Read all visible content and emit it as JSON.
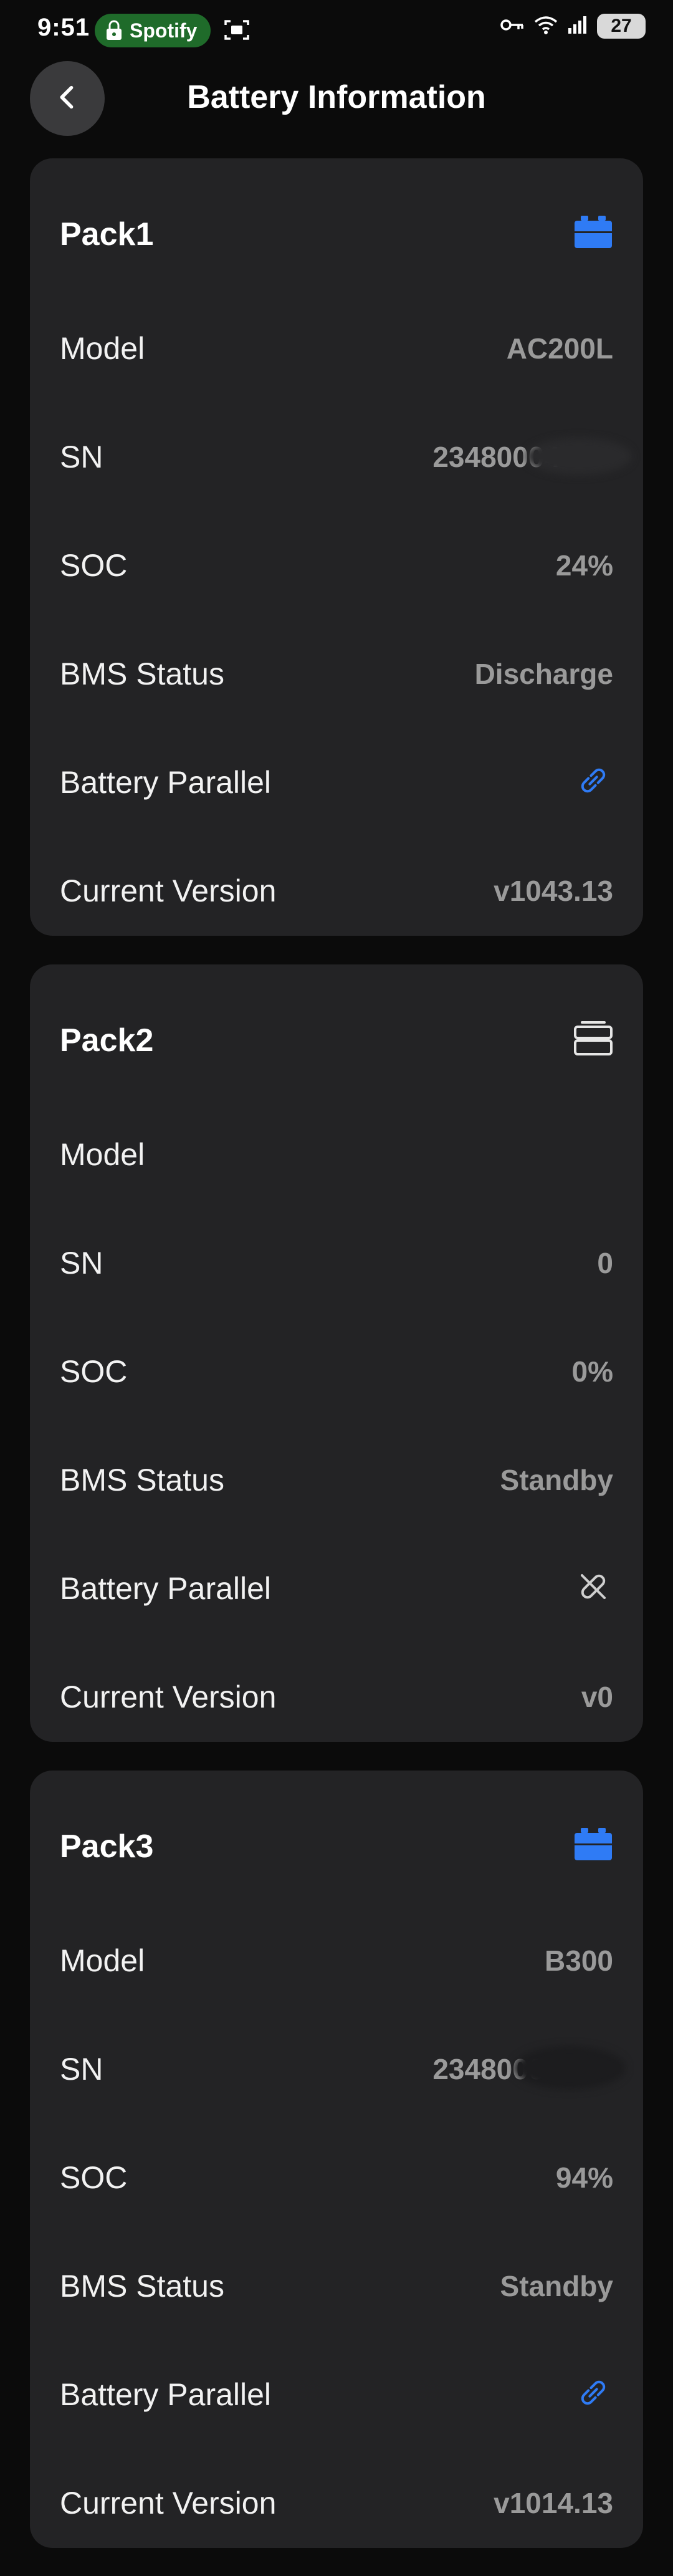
{
  "status_bar": {
    "time": "9:51",
    "app_pill": "Spotify",
    "battery": "27"
  },
  "header": {
    "title": "Battery Information"
  },
  "labels": {
    "model": "Model",
    "sn": "SN",
    "soc": "SOC",
    "bms_status": "BMS Status",
    "battery_parallel": "Battery Parallel",
    "current_version": "Current Version"
  },
  "colors": {
    "accent_blue": "#2f7bf5",
    "value_gray": "#9a9a9a",
    "card_bg": "#232325",
    "page_bg": "#0b0b0b"
  },
  "packs": [
    {
      "name": "Pack1",
      "icon": "battery-filled-icon",
      "model": "AC200L",
      "sn": "23480004",
      "soc": "24%",
      "bms_status": "Discharge",
      "parallel_icon": "link-icon",
      "current_version": "v1043.13"
    },
    {
      "name": "Pack2",
      "icon": "battery-outline-icon",
      "model": "",
      "sn": "0",
      "soc": "0%",
      "bms_status": "Standby",
      "parallel_icon": "unlink-icon",
      "current_version": "v0"
    },
    {
      "name": "Pack3",
      "icon": "battery-filled-icon",
      "model": "B300",
      "sn": "23480004",
      "soc": "94%",
      "bms_status": "Standby",
      "parallel_icon": "link-icon",
      "current_version": "v1014.13"
    }
  ]
}
